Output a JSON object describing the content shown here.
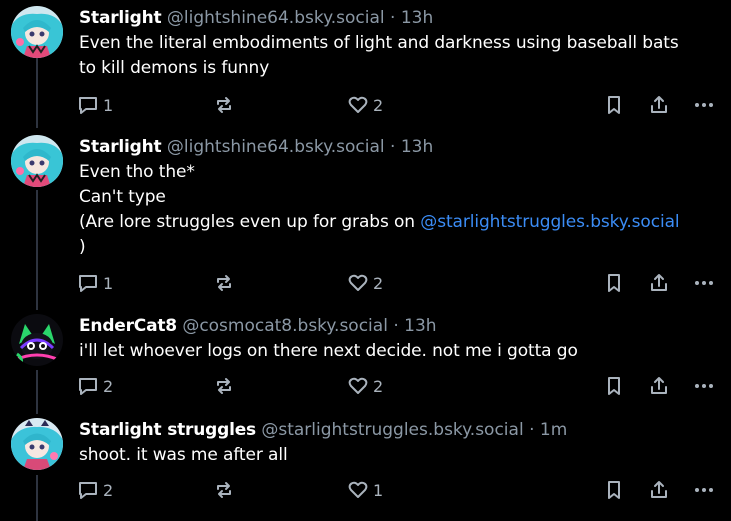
{
  "theme": {
    "background": "#000000",
    "text": "#ffffff",
    "muted": "#8b98a5",
    "link": "#3b8cf5",
    "icon": "#aab3bd"
  },
  "posts": [
    {
      "author_name": "Starlight",
      "handle": "@lightshine64.bsky.social",
      "sep": "·",
      "time": "13h",
      "lines": [
        "Even the literal embodiments of light and darkness using baseball bats",
        "to kill demons is funny"
      ],
      "reply_count": "1",
      "like_count": "2",
      "avatar": "starlight-avatar"
    },
    {
      "author_name": "Starlight",
      "handle": "@lightshine64.bsky.social",
      "sep": "·",
      "time": "13h",
      "lines": [
        "Even tho the*",
        "Can't type"
      ],
      "line3_text": "(Are lore struggles even up for grabs on ",
      "line3_mention": "@starlightstruggles.bsky.social",
      "line4_text": ")",
      "reply_count": "1",
      "like_count": "2",
      "avatar": "starlight-avatar"
    },
    {
      "author_name": "EnderCat8",
      "handle": "@cosmocat8.bsky.social",
      "sep": "·",
      "time": "13h",
      "lines": [
        "i'll let whoever logs on there next decide. not me i gotta go"
      ],
      "reply_count": "2",
      "like_count": "2",
      "avatar": "endercat-avatar"
    },
    {
      "author_name": "Starlight struggles",
      "handle": "@starlightstruggles.bsky.social",
      "sep": "·",
      "time": "1m",
      "lines": [
        "shoot. it was me after all"
      ],
      "reply_count": "2",
      "like_count": "1",
      "avatar": "starlight-struggles-avatar"
    }
  ],
  "icons": {
    "reply": "speech-bubble-icon",
    "repost": "repost-icon",
    "like": "heart-icon",
    "bookmark": "bookmark-icon",
    "share": "share-icon",
    "more": "more-icon"
  }
}
